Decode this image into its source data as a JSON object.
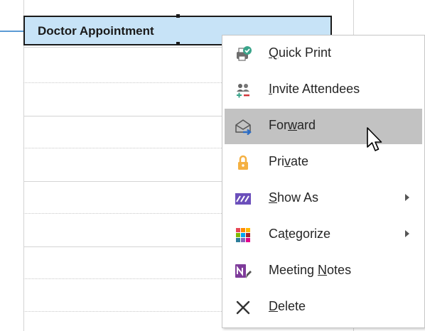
{
  "appointment": {
    "title": "Doctor Appointment"
  },
  "context_menu": {
    "items": [
      {
        "before": "",
        "accel": "Q",
        "after": "uick Print",
        "icon": "quick-print-icon",
        "has_submenu": false,
        "highlighted": false
      },
      {
        "before": "",
        "accel": "I",
        "after": "nvite Attendees",
        "icon": "invite-attendees-icon",
        "has_submenu": false,
        "highlighted": false
      },
      {
        "before": "For",
        "accel": "w",
        "after": "ard",
        "icon": "forward-icon",
        "has_submenu": false,
        "highlighted": true
      },
      {
        "before": "Pri",
        "accel": "v",
        "after": "ate",
        "icon": "lock-icon",
        "has_submenu": false,
        "highlighted": false
      },
      {
        "before": "",
        "accel": "S",
        "after": "how As",
        "icon": "show-as-icon",
        "has_submenu": true,
        "highlighted": false
      },
      {
        "before": "Ca",
        "accel": "t",
        "after": "egorize",
        "icon": "categorize-icon",
        "has_submenu": true,
        "highlighted": false
      },
      {
        "before": "Meeting ",
        "accel": "N",
        "after": "otes",
        "icon": "onenote-icon",
        "has_submenu": false,
        "highlighted": false
      },
      {
        "before": "",
        "accel": "D",
        "after": "elete",
        "icon": "delete-icon",
        "has_submenu": false,
        "highlighted": false
      }
    ]
  },
  "colors": {
    "appointment_fill": "#c7e3f7",
    "highlight": "#c2c2c2",
    "lock": "#f4b042",
    "show_as": "#6b4fbb",
    "onenote": "#7e3b9a"
  }
}
